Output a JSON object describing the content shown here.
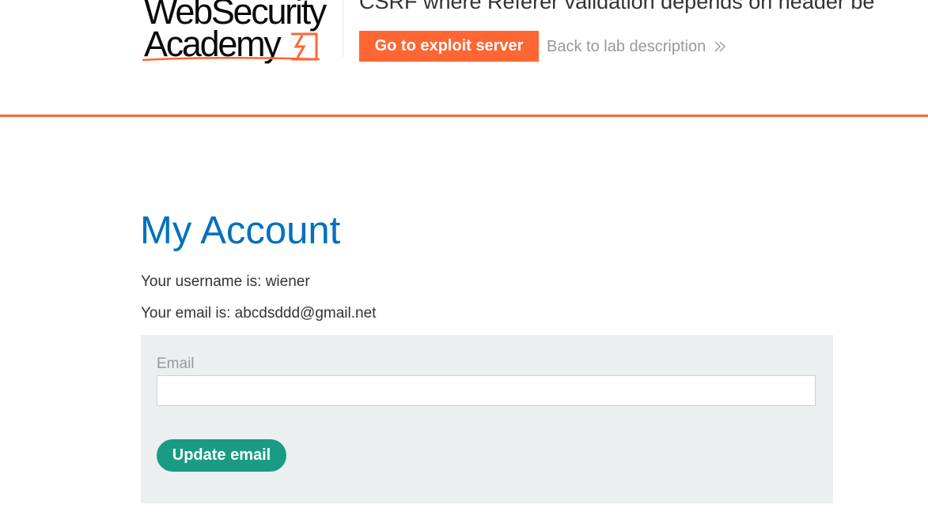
{
  "header": {
    "logo": {
      "line1": "WebSecurity",
      "line2": "Academy"
    },
    "lab_title": "CSRF where Referer validation depends on header be",
    "exploit_button_label": "Go to exploit server",
    "back_link_label": "Back to lab description"
  },
  "main": {
    "title": "My Account",
    "username_line": "Your username is: wiener",
    "email_line": "Your email is: abcdsddd@gmail.net",
    "form": {
      "email_label": "Email",
      "email_value": "",
      "submit_label": "Update email"
    }
  },
  "colors": {
    "accent": "#ff6633",
    "title_blue": "#0071bc",
    "button_green": "#199c83",
    "panel_bg": "#ebeff0"
  }
}
